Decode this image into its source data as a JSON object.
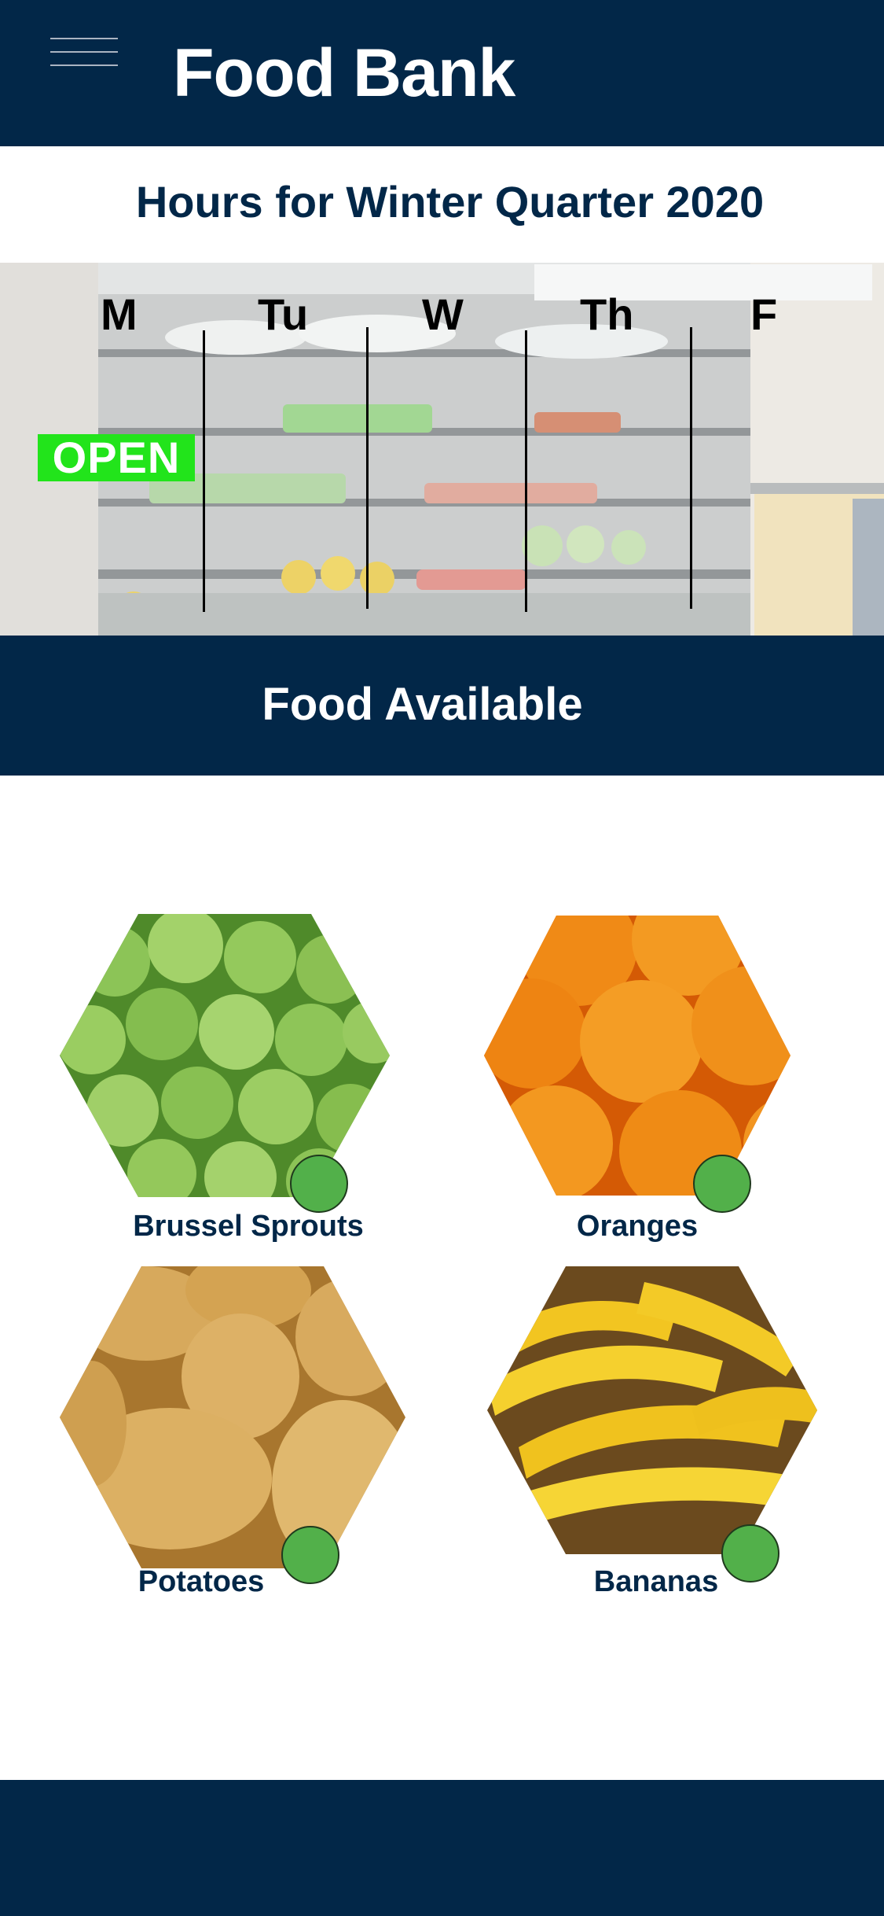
{
  "header": {
    "title": "Food Bank"
  },
  "hours": {
    "title": "Hours for Winter Quarter 2020",
    "days": [
      "M",
      "Tu",
      "W",
      "Th",
      "F"
    ],
    "status_badge": "OPEN"
  },
  "food_section": {
    "title": "Food Available",
    "items": [
      {
        "name": "Brussel Sprouts",
        "available": true
      },
      {
        "name": "Oranges",
        "available": true
      },
      {
        "name": "Potatoes",
        "available": true
      },
      {
        "name": "Bananas",
        "available": true
      }
    ]
  },
  "colors": {
    "primary": "#022748",
    "open_badge": "#22e41b",
    "available_dot": "#52b04a"
  },
  "icons": {
    "menu": "hamburger-menu-icon"
  }
}
